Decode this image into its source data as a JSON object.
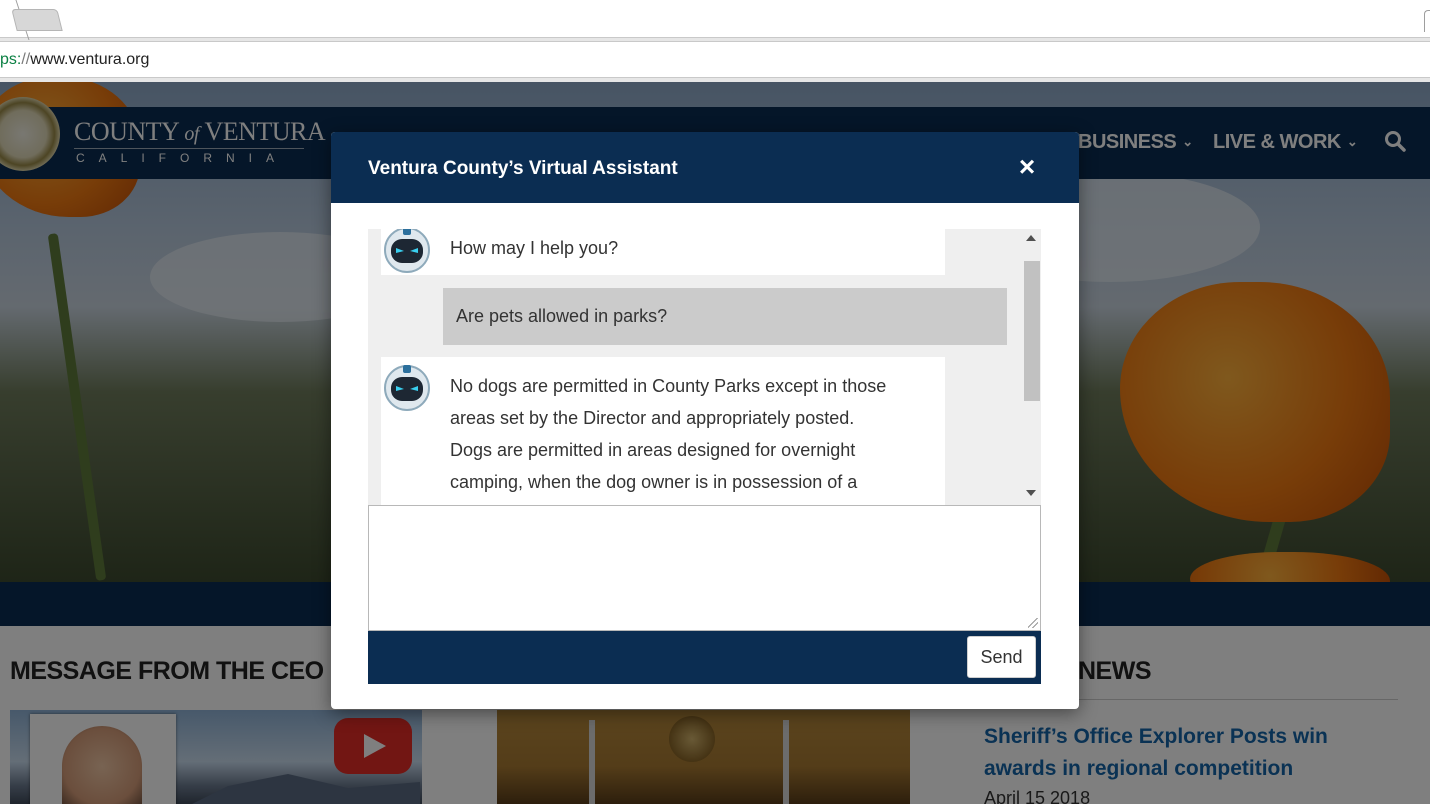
{
  "browser": {
    "url_scheme": "ps:",
    "url_sep": "//",
    "url_host": "www.ventura.org"
  },
  "site": {
    "logo_main_1": "COUNTY",
    "logo_main_of": "of",
    "logo_main_2": "VENTURA",
    "logo_sub": "CALIFORNIA",
    "nav": [
      {
        "label": "BUSINESS"
      },
      {
        "label": "LIVE & WORK"
      }
    ],
    "ceo_heading": "MESSAGE FROM THE CEO",
    "news_heading": "NEWS",
    "news_item_title": "Sheriff’s Office Explorer Posts win awards in regional competition",
    "news_item_date": "April 15 2018"
  },
  "assistant": {
    "title": "Ventura County’s Virtual Assistant",
    "close_label": "×",
    "messages": [
      {
        "from": "bot",
        "lines": [
          "How may I help you?"
        ]
      },
      {
        "from": "user",
        "lines": [
          "Are pets allowed in parks?"
        ]
      },
      {
        "from": "bot",
        "lines": [
          "No dogs are permitted in County Parks except in those",
          "areas set by the Director and appropriately posted.",
          "Dogs are permitted in areas designed for overnight",
          "camping, when the dog owner is in possession of a"
        ]
      }
    ],
    "input_value": "",
    "send_label": "Send"
  },
  "colors": {
    "navy": "#0b2d52",
    "link_blue": "#1565a8"
  }
}
